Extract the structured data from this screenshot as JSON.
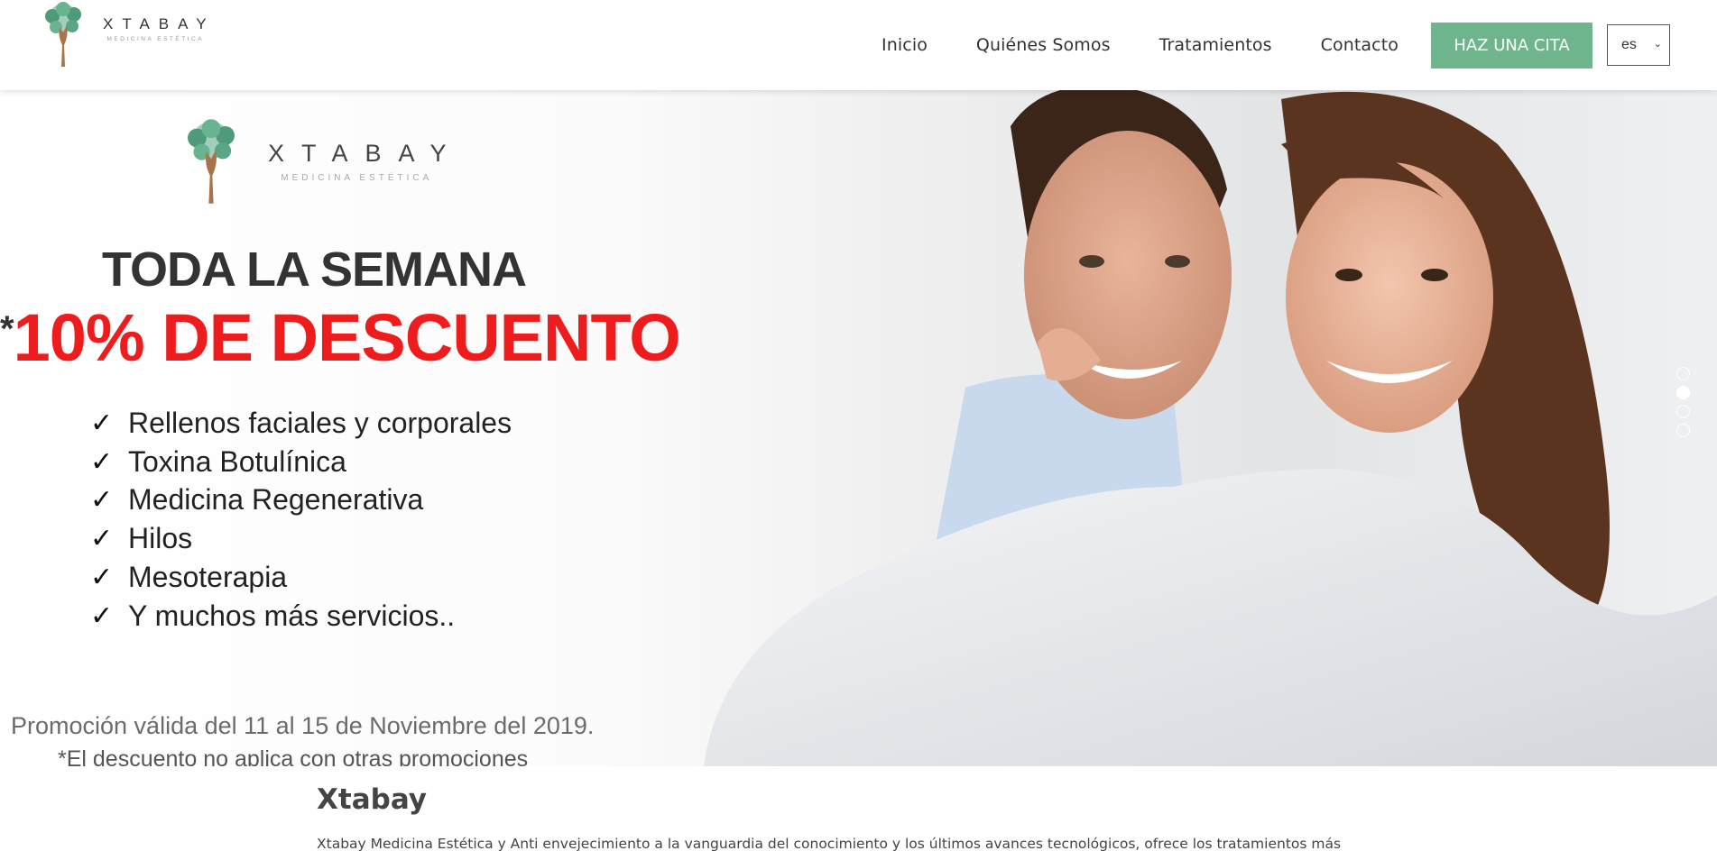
{
  "header": {
    "logo": {
      "name": "XTABAY",
      "subtitle": "MEDICINA ESTÉTICA"
    },
    "nav": [
      {
        "label": "Inicio"
      },
      {
        "label": "Quiénes Somos"
      },
      {
        "label": "Tratamientos"
      },
      {
        "label": "Contacto"
      }
    ],
    "cta_label": "HAZ UNA CITA",
    "language": {
      "selected": "es"
    }
  },
  "hero": {
    "slide_logo": {
      "name": "XTABAY",
      "subtitle": "MEDICINA ESTÉTICA"
    },
    "title": "TODA LA SEMANA",
    "discount_prefix": "*",
    "discount": "10% DE DESCUENTO",
    "services": [
      "Rellenos faciales y corporales",
      "Toxina Botulínica",
      "Medicina Regenerativa",
      "Hilos",
      "Mesoterapia",
      "Y muchos más servicios.."
    ],
    "validity": "Promoción válida del 11 al 15 de Noviembre  del 2019.",
    "note": "*El descuento no aplica con otras promociones",
    "slider": {
      "total": 4,
      "active_index": 2
    }
  },
  "intro": {
    "title": "Xtabay",
    "text": "Xtabay Medicina Estética y Anti envejecimiento a la vanguardia del conocimiento y los últimos avances tecnológicos, ofrece los tratamientos más"
  },
  "colors": {
    "accent": "#6eb48c",
    "discount": "#ee1c1c"
  }
}
